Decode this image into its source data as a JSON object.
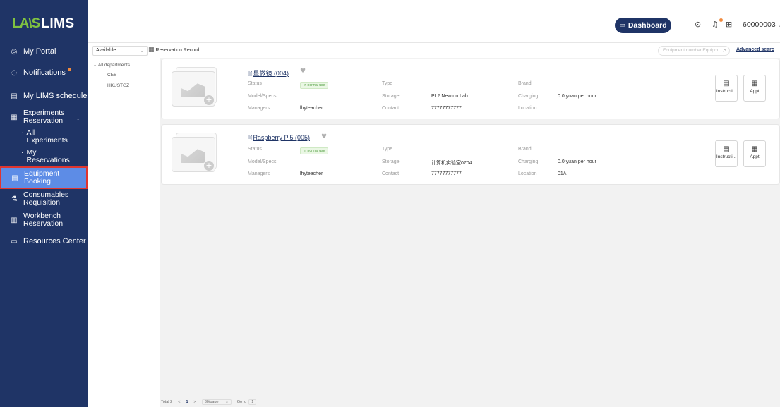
{
  "app": {
    "logo_mark": "LA\\S",
    "logo_text": "LIMS"
  },
  "sidebar": {
    "items": [
      {
        "label": "My Portal",
        "icon": "portal-icon"
      },
      {
        "label": "Notifications",
        "icon": "chat-icon"
      },
      {
        "label": "My LIMS schedule",
        "icon": "calendar-icon"
      },
      {
        "label": "Experiments Reservation",
        "icon": "grid-calendar-icon"
      },
      {
        "label": "Equipment Booking",
        "icon": "equipment-icon"
      },
      {
        "label": "Consumables Requisition",
        "icon": "flask-icon"
      },
      {
        "label": "Workbench Reservation",
        "icon": "workbench-icon"
      },
      {
        "label": "Resources Center",
        "icon": "folder-icon"
      }
    ],
    "sub_items": [
      {
        "label": "All Experiments"
      },
      {
        "label": "My Reservations"
      }
    ],
    "active": "Equipment Booking"
  },
  "topbar": {
    "dashboard_label": "Dashboard",
    "user": "60000003"
  },
  "filter": {
    "availability": "Available",
    "reservation_record": "Reservation Record",
    "search_placeholder": "Equipment number,Equipm",
    "advanced_search": "Advanced searc"
  },
  "tree": {
    "root": "All departments",
    "departments": [
      "CES",
      "HKUSTGZ"
    ]
  },
  "labels": {
    "status": "Status",
    "model": "Model/Specs",
    "managers": "Managers",
    "type": "Type",
    "storage": "Storage",
    "contact": "Contact",
    "brand": "Brand",
    "charging": "Charging",
    "location": "Location",
    "instructions": "Instructi...",
    "appt": "Appt"
  },
  "equipment": [
    {
      "title": "显微镜 (004)",
      "status": "In normal use",
      "model": "",
      "managers": "lhyteacher",
      "type": "",
      "storage": "PL2 Newton Lab",
      "contact": "77777777777",
      "brand": "",
      "charging": "0.0 yuan per hour",
      "location": ""
    },
    {
      "title": "Raspberry Pi5 (005)",
      "status": "In normal use",
      "model": "",
      "managers": "lhyteacher",
      "type": "",
      "storage": "计算机实验室0704",
      "contact": "77777777777",
      "brand": "",
      "charging": "0.0 yuan per hour",
      "location": "01A"
    }
  ],
  "pager": {
    "total": "Total 2",
    "prev": "<",
    "page": "1",
    "next": ">",
    "per_page": "30/page",
    "goto_label": "Go to",
    "goto_value": "1"
  },
  "colors": {
    "sidebar": "#1f3466",
    "active": "#5d8ce6",
    "highlight": "#e0352f",
    "dot": "#f08a3e"
  }
}
